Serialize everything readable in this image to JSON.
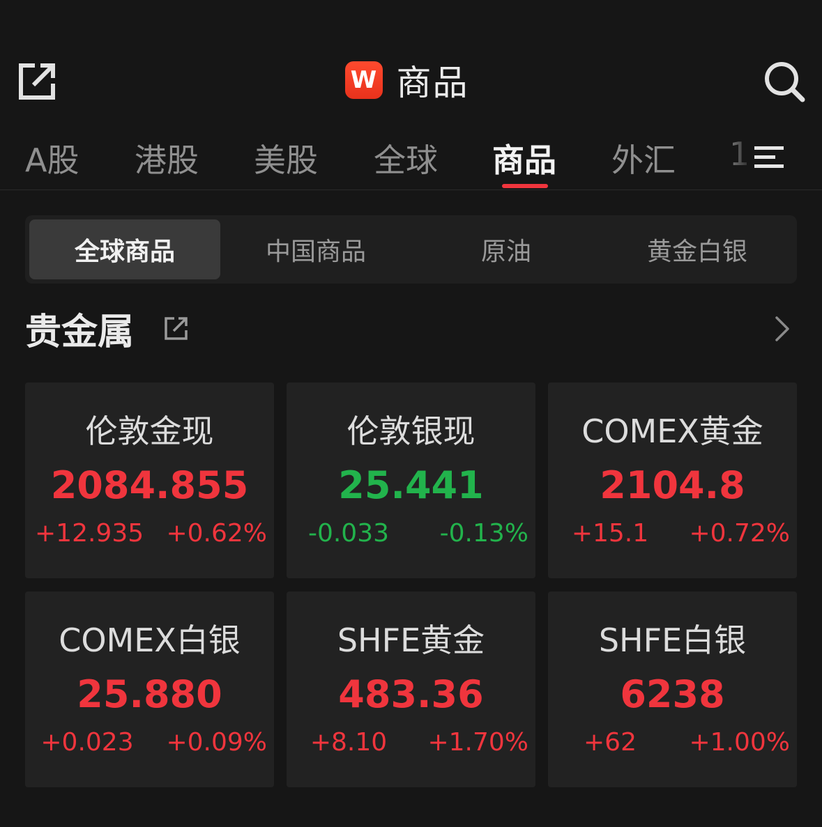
{
  "header": {
    "logo_letter": "W",
    "title": "商品"
  },
  "tabs": [
    {
      "label": "A股",
      "active": false
    },
    {
      "label": "港股",
      "active": false
    },
    {
      "label": "美股",
      "active": false
    },
    {
      "label": "全球",
      "active": false
    },
    {
      "label": "商品",
      "active": true
    },
    {
      "label": "外汇",
      "active": false
    },
    {
      "label": "1",
      "active": false
    }
  ],
  "segments": [
    {
      "label": "全球商品",
      "active": true
    },
    {
      "label": "中国商品",
      "active": false
    },
    {
      "label": "原油",
      "active": false
    },
    {
      "label": "黄金白银",
      "active": false
    }
  ],
  "section": {
    "title": "贵金属"
  },
  "cards": [
    {
      "name": "伦敦金现",
      "price": "2084.855",
      "change": "+12.935",
      "pct": "+0.62%",
      "direction": "up"
    },
    {
      "name": "伦敦银现",
      "price": "25.441",
      "change": "-0.033",
      "pct": "-0.13%",
      "direction": "down"
    },
    {
      "name": "COMEX黄金",
      "price": "2104.8",
      "change": "+15.1",
      "pct": "+0.72%",
      "direction": "up"
    },
    {
      "name": "COMEX白银",
      "price": "25.880",
      "change": "+0.023",
      "pct": "+0.09%",
      "direction": "up"
    },
    {
      "name": "SHFE黄金",
      "price": "483.36",
      "change": "+8.10",
      "pct": "+1.70%",
      "direction": "up"
    },
    {
      "name": "SHFE白银",
      "price": "6238",
      "change": "+62",
      "pct": "+1.00%",
      "direction": "up"
    }
  ],
  "colors": {
    "up": "#f0353d",
    "down": "#22b34c",
    "accent": "#f0353d",
    "background": "#161616",
    "card": "#222222"
  },
  "icons": {
    "share": "share-icon",
    "search": "search-icon",
    "menu": "menu-icon",
    "section_share": "share-icon",
    "chevron": "chevron-right-icon"
  }
}
